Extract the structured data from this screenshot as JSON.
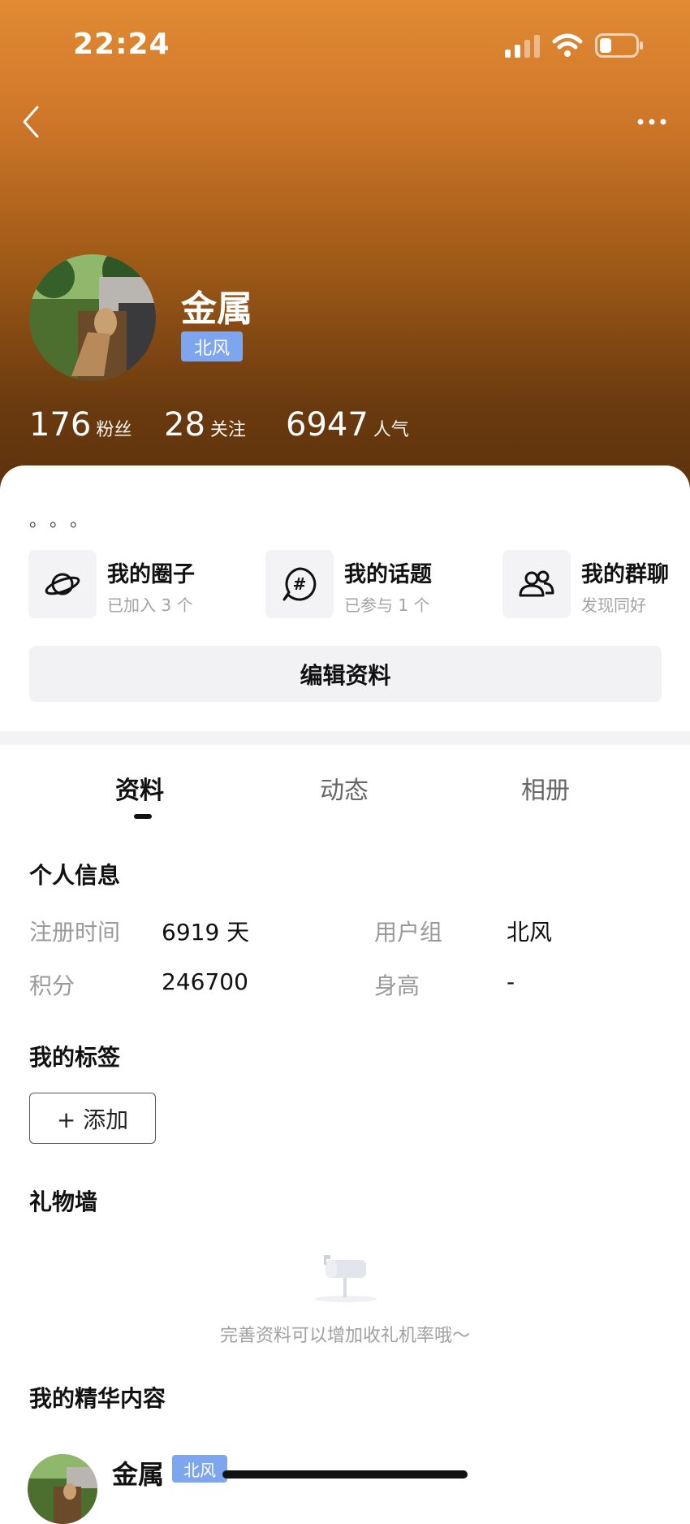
{
  "status": {
    "time": "22:24"
  },
  "profile": {
    "name": "金属",
    "badge": "北风",
    "stats": [
      {
        "num": "176",
        "label": "粉丝"
      },
      {
        "num": "28",
        "label": "关注"
      },
      {
        "num": "6947",
        "label": "人气"
      }
    ],
    "bio": "。。。"
  },
  "shortcuts": [
    {
      "title": "我的圈子",
      "sub": "已加入 3 个",
      "icon": "planet-icon"
    },
    {
      "title": "我的话题",
      "sub": "已参与 1 个",
      "icon": "hashtag-icon"
    },
    {
      "title": "我的群聊",
      "sub": "发现同好",
      "icon": "people-icon"
    }
  ],
  "edit_button": "编辑资料",
  "tabs": [
    {
      "label": "资料",
      "active": true
    },
    {
      "label": "动态",
      "active": false
    },
    {
      "label": "相册",
      "active": false
    }
  ],
  "personal_info": {
    "title": "个人信息",
    "rows": [
      {
        "label": "注册时间",
        "value": "6919 天"
      },
      {
        "label": "用户组",
        "value": "北风"
      },
      {
        "label": "积分",
        "value": "246700"
      },
      {
        "label": "身高",
        "value": "-"
      }
    ]
  },
  "tags": {
    "title": "我的标签",
    "add_label": "+ 添加"
  },
  "gift_wall": {
    "title": "礼物墙",
    "empty_text": "完善资料可以增加收礼机率哦～"
  },
  "featured": {
    "title": "我的精华内容",
    "post": {
      "author": "金属",
      "badge": "北风"
    }
  },
  "colors": {
    "badge": "#7ea6ee",
    "hero_top": "#e18a33",
    "hero_bottom": "#5a300c"
  }
}
